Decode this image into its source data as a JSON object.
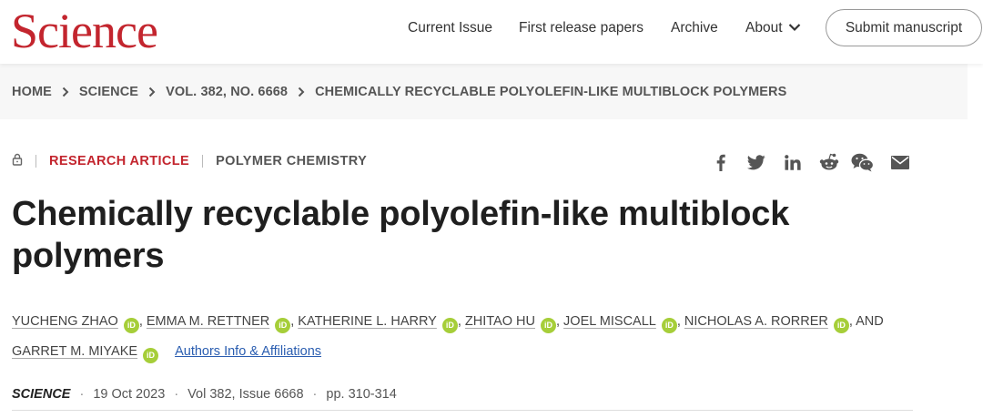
{
  "header": {
    "logo": "Science",
    "nav": {
      "current_issue": "Current Issue",
      "first_release": "First release papers",
      "archive": "Archive",
      "about": "About"
    },
    "submit": "Submit manuscript"
  },
  "breadcrumb": [
    "HOME",
    "SCIENCE",
    "VOL. 382, NO. 6668",
    "CHEMICALLY RECYCLABLE POLYOLEFIN-LIKE MULTIBLOCK POLYMERS"
  ],
  "article": {
    "kind": "RESEARCH ARTICLE",
    "subject": "POLYMER CHEMISTRY",
    "title": "Chemically recyclable polyolefin-like multiblock polymers",
    "authors": [
      "YUCHENG ZHAO",
      "EMMA M. RETTNER",
      "KATHERINE L. HARRY",
      "ZHITAO HU",
      "JOEL MISCALL",
      "NICHOLAS A. RORRER",
      "GARRET M. MIYAKE"
    ],
    "and_text": "AND",
    "affiliations_link": "Authors Info & Affiliations",
    "journal": "SCIENCE",
    "date": "19 Oct 2023",
    "volume": "Vol 382, Issue 6668",
    "pages": "pp. 310-314"
  },
  "icons": {
    "orcid": "iD",
    "share": [
      "facebook-icon",
      "twitter-icon",
      "linkedin-icon",
      "reddit-icon",
      "wechat-icon",
      "email-icon"
    ],
    "access": "lock-icon"
  },
  "colors": {
    "brand": "#c3252e",
    "orcid": "#a6ce39",
    "link": "#2a5db0"
  }
}
